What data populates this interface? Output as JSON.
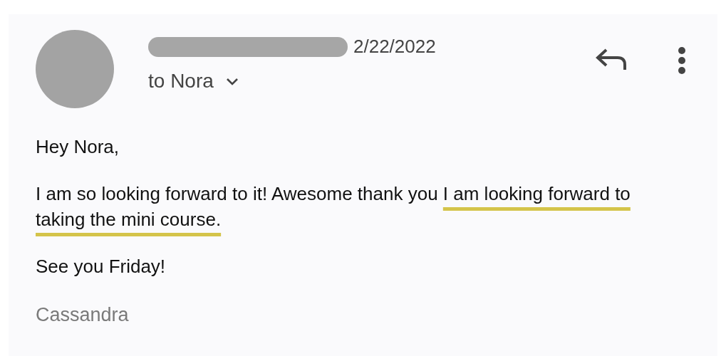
{
  "header": {
    "date": "2/22/2022",
    "recipient": "to Nora"
  },
  "body": [
    {
      "text": "Hey Nora,"
    },
    {
      "text": "I am so looking forward to it! Awesome thank you ",
      "underlined_text": "I am looking forward to taking the mini course."
    },
    {
      "text": "See you Friday!"
    }
  ],
  "signature": "Cassandra"
}
